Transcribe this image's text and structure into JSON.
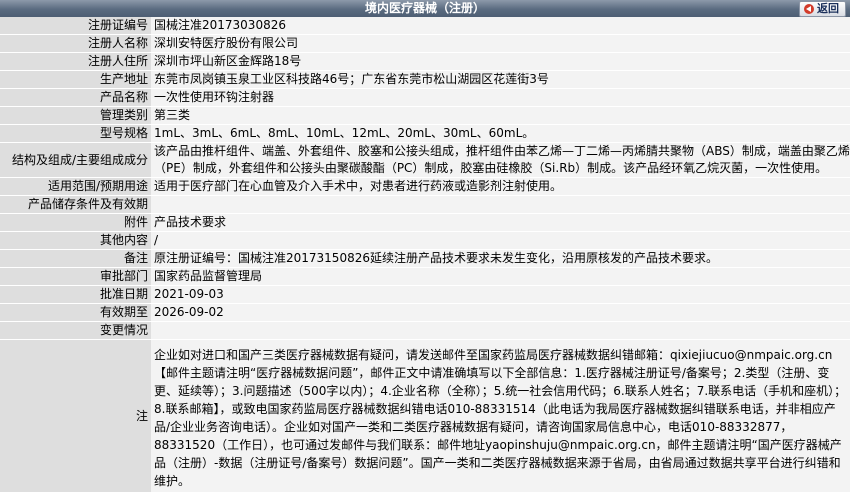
{
  "header": {
    "title": "境内医疗器械（注册）",
    "back_label": "返回"
  },
  "rows": [
    {
      "label": "注册证编号",
      "value": "国械注准20173030826"
    },
    {
      "label": "注册人名称",
      "value": "深圳安特医疗股份有限公司"
    },
    {
      "label": "注册人住所",
      "value": "深圳市坪山新区金辉路18号"
    },
    {
      "label": "生产地址",
      "value": "东莞市凤岗镇玉泉工业区科技路46号；广东省东莞市松山湖园区花莲街3号"
    },
    {
      "label": "产品名称",
      "value": "一次性使用环钩注射器"
    },
    {
      "label": "管理类别",
      "value": "第三类"
    },
    {
      "label": "型号规格",
      "value": "1mL、3mL、6mL、8mL、10mL、12mL、20mL、30mL、60mL。"
    },
    {
      "label": "结构及组成/主要组成成分",
      "value": "该产品由推杆组件、端盖、外套组件、胶塞和公接头组成，推杆组件由苯乙烯—丁二烯—丙烯腈共聚物（ABS）制成，端盖由聚乙烯（PE）制成，外套组件和公接头由聚碳酸酯（PC）制成，胶塞由硅橡胶（Si.Rb）制成。该产品经环氧乙烷灭菌，一次性使用。"
    },
    {
      "label": "适用范围/预期用途",
      "value": "适用于医疗部门在心血管及介入手术中，对患者进行药液或造影剂注射使用。"
    },
    {
      "label": "产品储存条件及有效期",
      "value": ""
    },
    {
      "label": "附件",
      "value": "产品技术要求"
    },
    {
      "label": "其他内容",
      "value": "/"
    },
    {
      "label": "备注",
      "value": "原注册证编号：国械注准20173150826延续注册产品技术要求未发生变化，沿用原核发的产品技术要求。"
    },
    {
      "label": "审批部门",
      "value": "国家药品监督管理局"
    },
    {
      "label": "批准日期",
      "value": "2021-09-03"
    },
    {
      "label": "有效期至",
      "value": "2026-09-02"
    },
    {
      "label": "变更情况",
      "value": ""
    },
    {
      "label": "注",
      "value": "企业如对进口和国产三类医疗器械数据有疑问，请发送邮件至国家药监局医疗器械数据纠错邮箱：qixiejiucuo@nmpaic.org.cn【邮件主题请注明“医疗器械数据问题”，邮件正文中请准确填写以下全部信息：1.医疗器械注册证号/备案号；2.类型（注册、变更、延续等）；3.问题描述（500字以内）；4.企业名称（全称）；5.统一社会信用代码；6.联系人姓名；7.联系电话（手机和座机）；8.联系邮箱】，或致电国家药监局医疗器械数据纠错电话010-88331514（此电话为我局医疗器械数据纠错联系电话，并非相应产品/企业业务咨询电话）。企业如对国产一类和二类医疗器械数据有疑问，请咨询国家局信息中心，电话010-88332877，88331520（工作日），也可通过发邮件与我们联系：邮件地址yaopinshuju@nmpaic.org.cn，邮件主题请注明“国产医疗器械产品（注册）-数据（注册证号/备案号）数据问题”。国产一类和二类医疗器械数据来源于省局，由省局通过数据共享平台进行纠错和维护。"
    }
  ]
}
